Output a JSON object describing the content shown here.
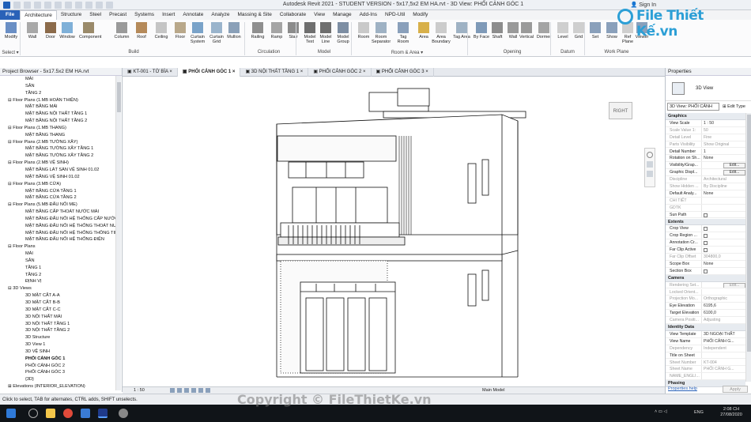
{
  "app": {
    "title": "Autodesk Revit 2021 - STUDENT VERSION - 5x17,5x2 EM HA.rvt - 3D View: PHỐI CẢNH GÓC 1",
    "sign_in": "Sign In"
  },
  "ribbon_tabs": [
    "File",
    "Architecture",
    "Structure",
    "Steel",
    "Precast",
    "Systems",
    "Insert",
    "Annotate",
    "Analyze",
    "Massing & Site",
    "Collaborate",
    "View",
    "Manage",
    "Add-Ins",
    "NPD-Util",
    "Modify"
  ],
  "ribbon_buttons": [
    "Modify",
    "Wall",
    "Door",
    "Window",
    "Component",
    "Column",
    "Roof",
    "Ceiling",
    "Floor",
    "Curtain System",
    "Curtain Grid",
    "Mullion",
    "Railing",
    "Ramp",
    "Stair",
    "Model Text",
    "Model Line",
    "Model Group",
    "Room",
    "Room Separator",
    "Tag Room",
    "Area",
    "Area Boundary",
    "Tag Area",
    "By Face",
    "Shaft",
    "Wall",
    "Vertical",
    "Dormer",
    "Level",
    "Grid",
    "Set",
    "Show",
    "Ref Plane",
    "Viewer"
  ],
  "ribbon_groups": [
    "Select ▾",
    "Build",
    "Circulation",
    "Model",
    "Room & Area ▾",
    "Opening",
    "Datum",
    "Work Plane"
  ],
  "browser": {
    "title": "Project Browser - 5x17.5x2 EM HA.rvt",
    "rows": [
      {
        "text": "MÁI",
        "indent": 3
      },
      {
        "text": "SÂN",
        "indent": 3
      },
      {
        "text": "TẦNG 2",
        "indent": 3
      },
      {
        "text": "⊟  Floor Plans (1.MB HOÀN THIỆN)",
        "indent": 1
      },
      {
        "text": "MẶT BẰNG MÁI",
        "indent": 3
      },
      {
        "text": "MẶT BẰNG NỘI THẤT TẦNG 1",
        "indent": 3
      },
      {
        "text": "MẶT BẰNG NỘI THẤT TẦNG 2",
        "indent": 3
      },
      {
        "text": "⊟  Floor Plans (1.MB THANG)",
        "indent": 1
      },
      {
        "text": "MẶT BẰNG THANG",
        "indent": 3
      },
      {
        "text": "⊟  Floor Plans (2.MB TƯỜNG XÂY)",
        "indent": 1
      },
      {
        "text": "MẶT BẰNG TƯỜNG XÂY TẦNG 1",
        "indent": 3
      },
      {
        "text": "MẶT BẰNG TƯỜNG XÂY TẦNG 2",
        "indent": 3
      },
      {
        "text": "⊟  Floor Plans (2.MB VỆ SINH)",
        "indent": 1
      },
      {
        "text": "MẶT BẰNG LÁT SÀN VỆ SINH 01.02",
        "indent": 3
      },
      {
        "text": "MẶT BẰNG VỆ SINH 01.02",
        "indent": 3
      },
      {
        "text": "⊟  Floor Plans (3.MB CỬA)",
        "indent": 1
      },
      {
        "text": "MẶT BẰNG CỬA TẦNG 1",
        "indent": 3
      },
      {
        "text": "MẶT BẰNG CỬA TẦNG 2",
        "indent": 3
      },
      {
        "text": "⊟  Floor Plans (5.MB ĐẤU NỐI ME)",
        "indent": 1
      },
      {
        "text": "MẶT BẰNG CẤP THOÁT NƯỚC MÁI",
        "indent": 3
      },
      {
        "text": "MẶT BẰNG ĐẤU NỐI HỆ THỐNG CẤP NƯỚC",
        "indent": 3
      },
      {
        "text": "MẶT BẰNG ĐẤU NỐI HỆ THỐNG THOÁT NƯỚC",
        "indent": 3
      },
      {
        "text": "MẶT BẰNG ĐẤU NỐI HỆ THỐNG THÔNG TIN",
        "indent": 3
      },
      {
        "text": "MẶT BẰNG ĐẤU NỐI HỆ THỐNG ĐIỆN",
        "indent": 3
      },
      {
        "text": "⊟  Floor Plans",
        "indent": 1
      },
      {
        "text": "MÁI",
        "indent": 3
      },
      {
        "text": "SÂN",
        "indent": 3
      },
      {
        "text": "TẦNG 1",
        "indent": 3
      },
      {
        "text": "TẦNG 2",
        "indent": 3
      },
      {
        "text": "ĐỊNH VỊ",
        "indent": 3
      },
      {
        "text": "⊟  3D Views",
        "indent": 1
      },
      {
        "text": "3D MẶT CẮT A-A",
        "indent": 3
      },
      {
        "text": "3D MẶT CẮT B-B",
        "indent": 3
      },
      {
        "text": "3D MẶT CẮT C-C",
        "indent": 3
      },
      {
        "text": "3D NỘI THẤT MÁI",
        "indent": 3
      },
      {
        "text": "3D NỘI THẤT TẦNG 1",
        "indent": 3
      },
      {
        "text": "3D NỘI THẤT TẦNG 2",
        "indent": 3
      },
      {
        "text": "3D Structure",
        "indent": 3
      },
      {
        "text": "3D View 1",
        "indent": 3
      },
      {
        "text": "3D VỆ SINH",
        "indent": 3
      },
      {
        "text": "PHỐI CẢNH GÓC 1",
        "indent": 3,
        "bold": true
      },
      {
        "text": "PHỐI CẢNH GÓC 2",
        "indent": 3
      },
      {
        "text": "PHỐI CẢNH GÓC 3",
        "indent": 3
      },
      {
        "text": "{3D}",
        "indent": 3
      },
      {
        "text": "⊞  Elevations (INTERIOR_ELEVATION)",
        "indent": 1
      }
    ]
  },
  "view_tabs": [
    {
      "label": "KT-001 - TỜ BÌA",
      "active": false
    },
    {
      "label": "PHỐI CẢNH GÓC 1",
      "active": true
    },
    {
      "label": "3D NỘI THẤT TẦNG 1",
      "active": false
    },
    {
      "label": "PHỐI CẢNH GÓC 2",
      "active": false
    },
    {
      "label": "PHỐI CẢNH GÓC 3",
      "active": false
    }
  ],
  "viewcube": {
    "face": "RIGHT"
  },
  "view_bar": {
    "scale": "1 : 50",
    "model": "Main Model"
  },
  "properties": {
    "title": "Properties",
    "type": "3D View",
    "selector": "3D View: PHỐI CẢNH",
    "edit_type": "Edit Type",
    "rows": [
      {
        "section": "Graphics"
      },
      {
        "k": "View Scale",
        "v": "1 : 50"
      },
      {
        "k": "Scale Value 1:",
        "v": "50",
        "dim": true
      },
      {
        "k": "Detail Level",
        "v": "Fine",
        "dim": true
      },
      {
        "k": "Parts Visibility",
        "v": "Show Original",
        "dim": true
      },
      {
        "k": "Detail Number",
        "v": "1"
      },
      {
        "k": "Rotation on Sh...",
        "v": "None"
      },
      {
        "k": "Visibility/Grap...",
        "v": "Edit...",
        "btn": true
      },
      {
        "k": "Graphic Displ...",
        "v": "Edit...",
        "btn": true
      },
      {
        "k": "Discipline",
        "v": "Architectural",
        "dim": true
      },
      {
        "k": "Show Hidden ...",
        "v": "By Discipline",
        "dim": true
      },
      {
        "k": "Default Analy...",
        "v": "None"
      },
      {
        "k": "CHI TIẾT",
        "v": "",
        "dim": true
      },
      {
        "k": "GDTK",
        "v": "",
        "dim": true
      },
      {
        "k": "Sun Path",
        "v": "",
        "check": true
      },
      {
        "section": "Extents"
      },
      {
        "k": "Crop View",
        "v": "",
        "check": true
      },
      {
        "k": "Crop Region ...",
        "v": "",
        "check": true
      },
      {
        "k": "Annotation Cr...",
        "v": "",
        "check": true
      },
      {
        "k": "Far Clip Active",
        "v": "",
        "check": true
      },
      {
        "k": "Far Clip Offset",
        "v": "304800,0",
        "dim": true
      },
      {
        "k": "Scope Box",
        "v": "None"
      },
      {
        "k": "Section Box",
        "v": "",
        "check": true
      },
      {
        "section": "Camera"
      },
      {
        "k": "Rendering Set...",
        "v": "Edit...",
        "btn": true,
        "dim": true
      },
      {
        "k": "Locked Orient...",
        "v": "",
        "dim": true
      },
      {
        "k": "Projection Mo...",
        "v": "Orthographic",
        "dim": true
      },
      {
        "k": "Eye Elevation",
        "v": "6195,6"
      },
      {
        "k": "Target Elevation",
        "v": "6100,0"
      },
      {
        "k": "Camera Positi...",
        "v": "Adjusting",
        "dim": true
      },
      {
        "section": "Identity Data"
      },
      {
        "k": "View Template",
        "v": "3D NGOẠI THẤT"
      },
      {
        "k": "View Name",
        "v": "PHỐI CẢNH G..."
      },
      {
        "k": "Dependency",
        "v": "Independent",
        "dim": true
      },
      {
        "k": "Title on Sheet",
        "v": ""
      },
      {
        "k": "Sheet Number",
        "v": "KT-004",
        "dim": true
      },
      {
        "k": "Sheet Name",
        "v": "PHỐI CẢNH G...",
        "dim": true
      },
      {
        "k": "NAME_ENGLI...",
        "v": "",
        "dim": true
      },
      {
        "section": "Phasing"
      }
    ],
    "help": "Properties help",
    "apply": "Apply"
  },
  "status": {
    "text": "Click to select, TAB for alternates, CTRL adds, SHIFT unselects."
  },
  "taskbar": {
    "lang": "ENG",
    "time": "2:08 CH",
    "date": "27/08/2020"
  },
  "watermark": {
    "logo": "File Thiết Kế.vn",
    "copyright": "Copyright © FileThietKe.vn"
  },
  "colors": {
    "file_tab": "#2a62b8",
    "logo": "#2c9fd6"
  }
}
